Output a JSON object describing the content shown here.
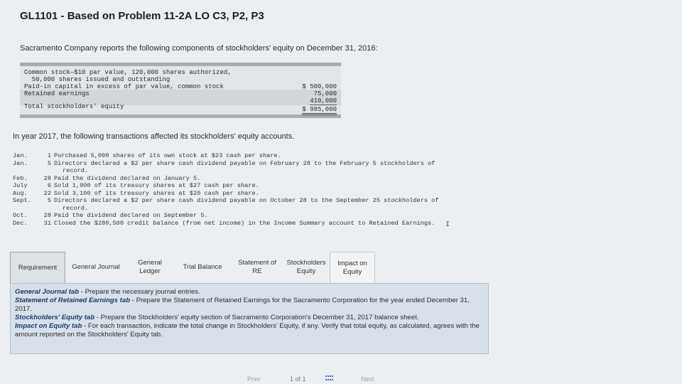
{
  "page": {
    "title": "GL1101 - Based on Problem 11-2A LO C3, P2, P3",
    "intro": "Sacramento Company reports the following components of stockholders' equity on December 31, 2016:"
  },
  "equity": {
    "rows": [
      {
        "label": "Common stock—$10 par value, 120,000 shares authorized,",
        "amount": ""
      },
      {
        "label": "  50,000 shares issued and outstanding",
        "amount": "$ 500,000"
      },
      {
        "label": "Paid-in capital in excess of par value, common stock",
        "amount": "75,000"
      },
      {
        "label": "Retained earnings",
        "amount": "410,000"
      },
      {
        "label": "Total stockholders' equity",
        "amount": "$ 985,000"
      }
    ]
  },
  "year_intro": "In year 2017, the following transactions affected its stockholders' equity accounts.",
  "transactions": [
    {
      "month": "Jan.",
      "day": "1",
      "text": "Purchased 5,000 shares of its own stock at $23 cash per share."
    },
    {
      "month": "Jan.",
      "day": "5",
      "text": "Directors declared a $2 per share cash dividend payable on February 28 to the February 5 stockholders of"
    },
    {
      "month": "",
      "day": "",
      "text": "record."
    },
    {
      "month": "Feb.",
      "day": "28",
      "text": "Paid the dividend declared on January 5."
    },
    {
      "month": "July",
      "day": "6",
      "text": "Sold 1,900 of its treasury shares at $27 cash per share."
    },
    {
      "month": "Aug.",
      "day": "22",
      "text": "Sold 3,100 of its treasury shares at $20 cash per share."
    },
    {
      "month": "Sept.",
      "day": "5",
      "text": "Directors declared a $2 per share cash dividend payable on October 28 to the September 25 stockholders of"
    },
    {
      "month": "",
      "day": "",
      "text": "record."
    },
    {
      "month": "Oct.",
      "day": "28",
      "text": "Paid the dividend declared on September 5."
    },
    {
      "month": "Dec.",
      "day": "31",
      "text": "Closed the $280,500 credit balance (from net income) in the Income Summary account to Retained Earnings."
    }
  ],
  "tabs": [
    {
      "label": "Requirement"
    },
    {
      "label": "General Journal"
    },
    {
      "label": "General Ledger"
    },
    {
      "label": "Trial Balance"
    },
    {
      "label": "Statement of RE"
    },
    {
      "label": "Stockholders Equity"
    },
    {
      "label": "Impact on Equity"
    }
  ],
  "panel": {
    "items": [
      {
        "name": "General Journal tab",
        "text": " - Prepare the necessary journal entries."
      },
      {
        "name": "Statement of Retained Earnings tab",
        "text": " - Prepare the Statement of Retained Earnings for the Sacramento Corporation for the year ended December 31, 2017."
      },
      {
        "name": "Stockholders' Equity tab",
        "text": " - Prepare the Stockholders' equity section of Sacramento Corporation's December 31, 2017 balance sheet."
      },
      {
        "name": "Impact on Equity tab",
        "text": " - For each transaction, indicate the total change in Stockholders' Equity, if any.  Verify that total equity, as calculated, agrees with the amount reported on the Stockholders' Equity tab."
      }
    ]
  },
  "pager": {
    "prev": "Prev",
    "position": "1 of 1",
    "next": "Next"
  },
  "colors": {
    "panel_bg": "#d8e1ea",
    "panel_heading": "#1f3a68",
    "grid_icon": "#3c6fb0"
  },
  "icons": {
    "pager_grid": "grid-icon"
  }
}
